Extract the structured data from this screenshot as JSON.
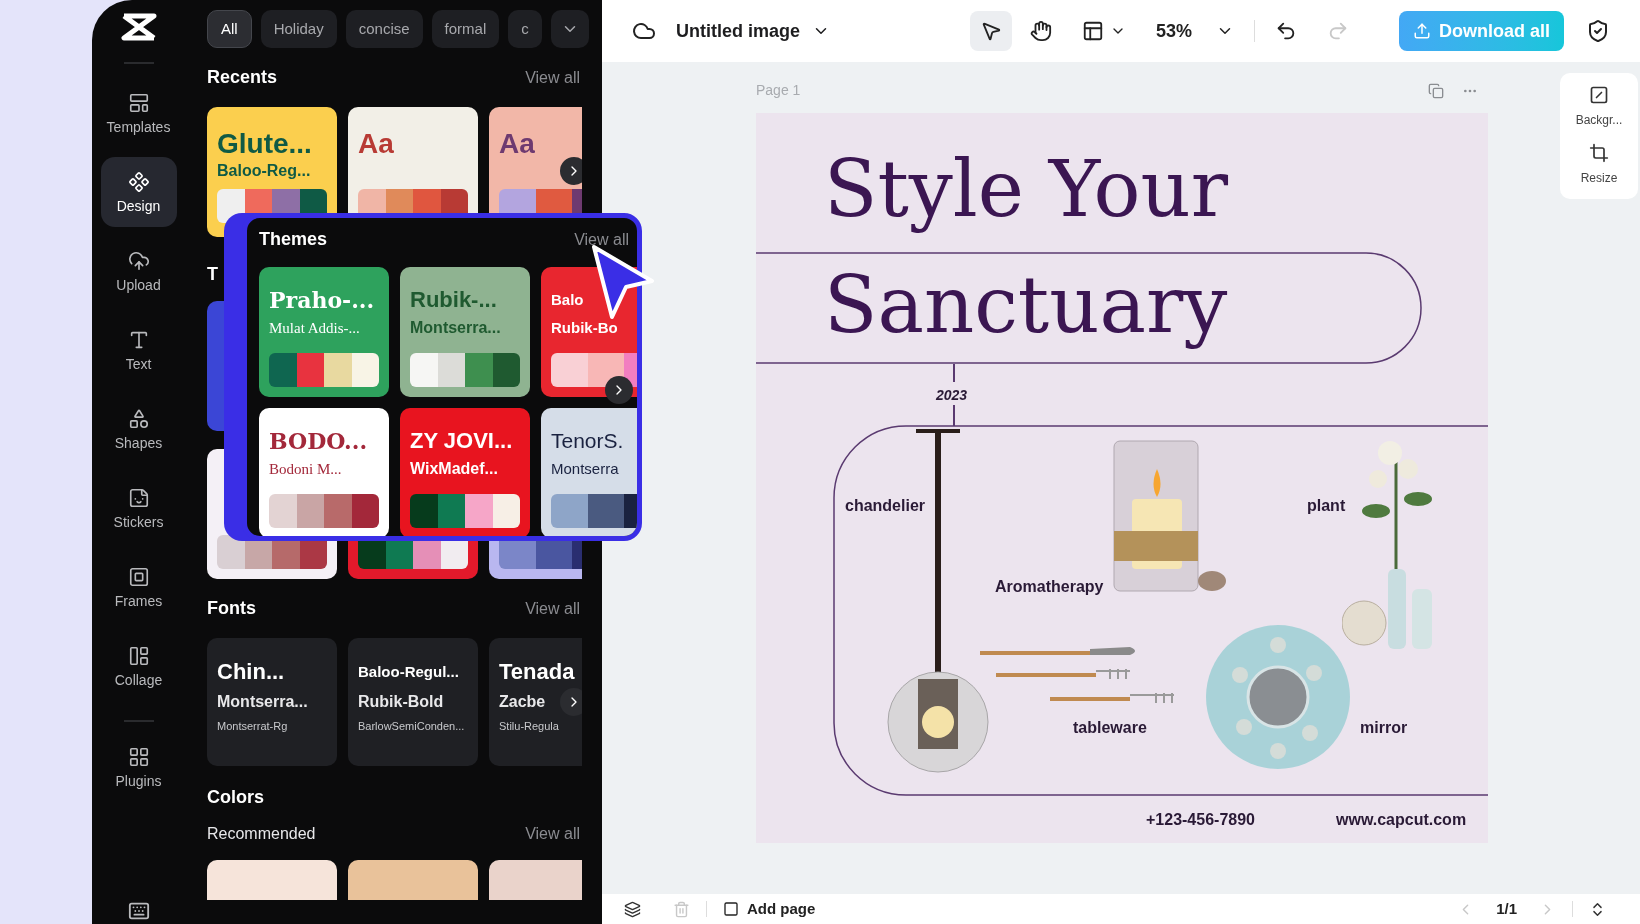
{
  "sidebar": {
    "items": [
      {
        "label": "Templates",
        "selected": false
      },
      {
        "label": "Design",
        "selected": true
      },
      {
        "label": "Upload",
        "selected": false
      },
      {
        "label": "Text",
        "selected": false
      },
      {
        "label": "Shapes",
        "selected": false
      },
      {
        "label": "Stickers",
        "selected": false
      },
      {
        "label": "Frames",
        "selected": false
      },
      {
        "label": "Collage",
        "selected": false
      },
      {
        "label": "Plugins",
        "selected": false
      }
    ]
  },
  "filters": [
    {
      "label": "All",
      "selected": true
    },
    {
      "label": "Holiday",
      "selected": false
    },
    {
      "label": "concise",
      "selected": false
    },
    {
      "label": "formal",
      "selected": false
    },
    {
      "label": "c",
      "selected": false
    }
  ],
  "recents": {
    "title": "Recents",
    "view_all": "View all",
    "cards": [
      {
        "heading": "Glute...",
        "subheading": "Baloo-Reg...",
        "color": "#fbcf4e",
        "palette": [
          {
            "color": "#efefef"
          },
          {
            "color": "#ef6a5c"
          },
          {
            "color": "#8e6fa6"
          },
          {
            "color": "#0f5a45"
          }
        ]
      },
      {
        "heading": "Aa",
        "color": "#f2efe7",
        "palette": [
          {
            "color": "#f0b5a6"
          },
          {
            "color": "#e08a5a"
          },
          {
            "color": "#e0563f"
          },
          {
            "color": "#b83a34"
          }
        ]
      },
      {
        "heading": "Aa",
        "color": "#f2b7a8",
        "palette": [
          {
            "color": "#b3a5df"
          },
          {
            "color": "#e05a40"
          },
          {
            "color": "#6e3a70"
          }
        ]
      }
    ]
  },
  "themes_behind": {
    "title": "T",
    "first_row": [
      {
        "color": "#3b46d6"
      }
    ],
    "second_row": [
      {
        "color": "#f4f0f6",
        "palette": [
          {
            "color": "#d9cfd3"
          },
          {
            "color": "#c7a7a7"
          },
          {
            "color": "#b66a6a"
          },
          {
            "color": "#ab3845"
          }
        ]
      },
      {
        "color": "#e3192b",
        "palette": [
          {
            "color": "#063b1c"
          },
          {
            "color": "#0f7a52"
          },
          {
            "color": "#e58fb7"
          },
          {
            "color": "#f1ecf0"
          }
        ]
      },
      {
        "color": "#b9b7f0",
        "palette": [
          {
            "color": "#7b86c8"
          },
          {
            "color": "#4a56a0"
          },
          {
            "color": "#2a2e70"
          }
        ]
      }
    ]
  },
  "themes": {
    "title": "Themes",
    "view_all": "View all",
    "cards": [
      {
        "kind": "serif",
        "heading": "Praho-...",
        "subheading": "Mulat Addis-...",
        "color": "#2ea25d",
        "palette": [
          {
            "color": "#0f6650"
          },
          {
            "color": "#e8333f"
          },
          {
            "color": "#e8d9a0"
          },
          {
            "color": "#f8f4e6"
          }
        ]
      },
      {
        "kind": "sans",
        "heading": "Rubik-...",
        "subheading": "Montserra...",
        "color": "#8fb391",
        "palette": [
          {
            "color": "#f6f6f4"
          },
          {
            "color": "#dcdcd8"
          },
          {
            "color": "#3e8f4f"
          },
          {
            "color": "#1f5a30"
          }
        ]
      },
      {
        "kind": "compact",
        "heading": "Balo",
        "subheading": "Rubik-Bo",
        "color": "#e8262f",
        "palette": [
          {
            "color": "#f9d0d5"
          },
          {
            "color": "#f8b7b6"
          },
          {
            "color": "#f27ec0"
          }
        ]
      },
      {
        "kind": "serif",
        "heading": "BODO...",
        "subheading": "Bodoni M...",
        "color": "#ffffff",
        "palette": [
          {
            "color": "#e3d3d3"
          },
          {
            "color": "#c9a5a5"
          },
          {
            "color": "#b86a6a"
          },
          {
            "color": "#a3283a"
          }
        ]
      },
      {
        "kind": "sans",
        "heading": "ZY JOVI...",
        "subheading": "WixMadef...",
        "color": "#e8141f",
        "palette": [
          {
            "color": "#063b1c"
          },
          {
            "color": "#0f7a52"
          },
          {
            "color": "#f6a6c8"
          },
          {
            "color": "#f7efe6"
          }
        ]
      },
      {
        "kind": "light",
        "heading": "TenorS.",
        "subheading": "Montserra",
        "color": "#d5dde8",
        "palette": [
          {
            "color": "#8ea5c8"
          },
          {
            "color": "#4a5a80"
          },
          {
            "color": "#1a2240"
          }
        ]
      }
    ]
  },
  "fonts": {
    "title": "Fonts",
    "view_all": "View all",
    "cards": [
      {
        "kind": "large",
        "lines": [
          "Chin...",
          "Montserra...",
          "Montserrat-Rg"
        ]
      },
      {
        "kind": "small",
        "lines": [
          "Baloo-Regul...",
          "Rubik-Bold",
          "BarlowSemiConden..."
        ]
      },
      {
        "kind": "large",
        "lines": [
          "Tenada",
          "Zacbe",
          "Stilu-Regula"
        ]
      }
    ]
  },
  "colors": {
    "title": "Colors",
    "subtitle": "Recommended",
    "view_all": "View all",
    "swatches": [
      {
        "color": "#f6e4da"
      },
      {
        "color": "#e9c29a"
      },
      {
        "color": "#ead3cb"
      }
    ]
  },
  "topbar": {
    "title": "Untitled image",
    "tools": [
      {
        "kind": "select",
        "selected": true
      },
      {
        "kind": "hand",
        "selected": false
      }
    ],
    "zoom": "53%",
    "download": "Download all"
  },
  "canvas": {
    "page_label": "Page 1",
    "poster": {
      "title_lines": [
        "Style Your",
        "Sanctuary"
      ],
      "year": "2023",
      "labels": [
        {
          "text": "chandelier"
        },
        {
          "text": "Aromatherapy"
        },
        {
          "text": "plant"
        },
        {
          "text": "tableware"
        },
        {
          "text": "mirror"
        }
      ],
      "phone": "+123-456-7890",
      "website": "www.capcut.com"
    }
  },
  "side_tools": [
    {
      "label": "Backgr..."
    },
    {
      "label": "Resize"
    }
  ],
  "bottom_bar": {
    "add_page": "Add page",
    "page_count": "1/1"
  }
}
